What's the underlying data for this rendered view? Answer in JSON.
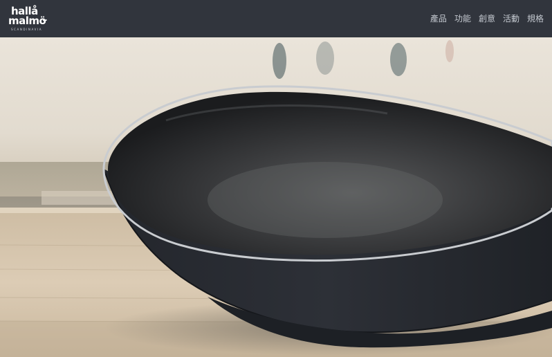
{
  "brand": {
    "line1": "hallå",
    "line2": "malmö",
    "dots": "..",
    "tagline": "SCANDINAVIA"
  },
  "nav": {
    "items": [
      "產品",
      "功能",
      "創意",
      "活動",
      "規格"
    ]
  },
  "colors": {
    "header_bg": "#31353d",
    "nav_text": "#c4c9d0",
    "pan_body": "#2a2d33",
    "wood": "#d6c3ab"
  },
  "hero": {
    "subject": "black non-stick wok on wooden countertop"
  }
}
